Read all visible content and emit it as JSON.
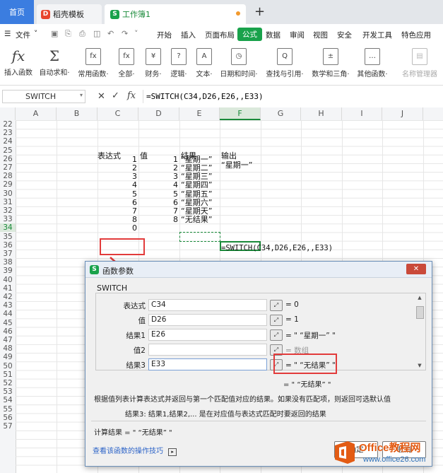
{
  "tabs": {
    "home": "首页",
    "template": "稻壳模板",
    "workbook": "工作簿1",
    "add": "+"
  },
  "menu": {
    "file": "文件",
    "items": [
      "开始",
      "插入",
      "页面布局",
      "公式",
      "数据",
      "审阅",
      "视图",
      "安全",
      "开发工具",
      "特色应用"
    ]
  },
  "ribbon": [
    {
      "label": "插入函数",
      "icon": "fx"
    },
    {
      "label": "自动求和·",
      "icon": "Σ"
    },
    {
      "label": "常用函数·",
      "icon": "fx"
    },
    {
      "label": "全部·",
      "icon": "fx"
    },
    {
      "label": "财务·",
      "icon": "¥"
    },
    {
      "label": "逻辑·",
      "icon": "?"
    },
    {
      "label": "文本·",
      "icon": "A"
    },
    {
      "label": "日期和时间·",
      "icon": "◷"
    },
    {
      "label": "查找与引用·",
      "icon": "Q"
    },
    {
      "label": "数学和三角·",
      "icon": "±"
    },
    {
      "label": "其他函数·",
      "icon": "…"
    },
    {
      "label": "名称管理器",
      "icon": "▤"
    }
  ],
  "formula_bar": {
    "name_box": "SWITCH",
    "formula": "=SWITCH(C34,D26,E26,,E33)"
  },
  "columns": [
    "A",
    "B",
    "C",
    "D",
    "E",
    "F",
    "G",
    "H",
    "I",
    "J"
  ],
  "rows": [
    "22",
    "23",
    "24",
    "25",
    "26",
    "27",
    "28",
    "29",
    "30",
    "31",
    "32",
    "33",
    "34",
    "35",
    "36",
    "37",
    "38",
    "39",
    "40",
    "41",
    "42",
    "43",
    "44",
    "45",
    "46",
    "47",
    "48",
    "49",
    "50",
    "51",
    "52",
    "53",
    "54",
    "55",
    "56",
    "57"
  ],
  "sheet": {
    "headers": {
      "c": "表达式",
      "d": "值",
      "e": "结果",
      "f": "输出"
    },
    "c_vals": [
      "1",
      "2",
      "3",
      "4",
      "5",
      "6",
      "7",
      "8",
      "0"
    ],
    "d_vals": [
      "1",
      "2",
      "3",
      "4",
      "5",
      "6",
      "7",
      "8"
    ],
    "e_vals": [
      "“星期一”",
      "“星期二”",
      "“星期三”",
      "“星期四”",
      "“星期五”",
      "“星期六”",
      "“星期天”",
      "“无结果”"
    ],
    "f26": "“星期一”",
    "f34": "=SWITCH(C34,D26,E26,,E33)"
  },
  "dialog": {
    "title": "函数参数",
    "function_name": "SWITCH",
    "args": [
      {
        "label": "表达式",
        "value": "C34",
        "result": "= 0"
      },
      {
        "label": "值",
        "value": "D26",
        "result": "= 1"
      },
      {
        "label": "结果1",
        "value": "E26",
        "result": "= \" “星期一” \""
      },
      {
        "label": "值2",
        "value": "",
        "result": "= 数组"
      },
      {
        "label": "结果3",
        "value": "E33",
        "result": "= \" “无结果” \""
      }
    ],
    "overall_result": "= \" “无结果” \"",
    "description": "根据值列表计算表达式并返回与第一个匹配值对应的结果。如果没有匹配项，则返回可选默认值",
    "arg_help": "结果3:  结果1,结果2,... 是在对应值与表达式匹配时要返回的结果",
    "calc_result": "计算结果 = \" “无结果” \"",
    "help_link": "查看该函数的操作技巧",
    "ok": "确定",
    "cancel": "取消"
  },
  "watermark": {
    "brand": "Office教程网",
    "url": "www.office26.com"
  }
}
